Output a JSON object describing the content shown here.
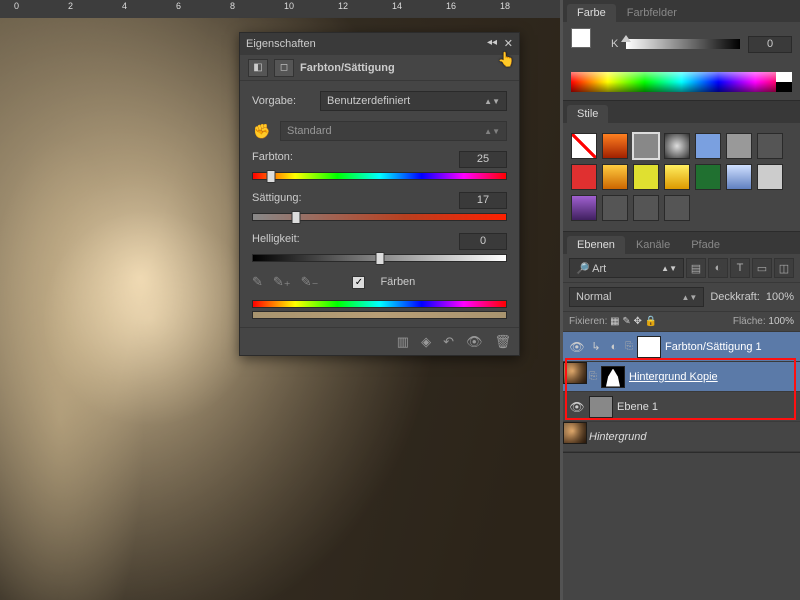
{
  "ruler": {
    "marks": [
      "0",
      "2",
      "4",
      "6",
      "8",
      "10",
      "12",
      "14",
      "16",
      "18"
    ]
  },
  "props": {
    "title": "Eigenschaften",
    "adjustment_name": "Farbton/Sättigung",
    "preset_label": "Vorgabe:",
    "preset_value": "Benutzerdefiniert",
    "channel_value": "Standard",
    "hue_label": "Farbton:",
    "hue_value": "25",
    "sat_label": "Sättigung:",
    "sat_value": "17",
    "lgt_label": "Helligkeit:",
    "lgt_value": "0",
    "colorize_label": "Färben"
  },
  "color_panel": {
    "tabs": [
      "Farbe",
      "Farbfelder"
    ],
    "k_label": "K",
    "k_value": "0"
  },
  "styles_panel": {
    "tab": "Stile"
  },
  "layers_panel": {
    "tabs": [
      "Ebenen",
      "Kanäle",
      "Pfade"
    ],
    "search": "Art",
    "blend": "Normal",
    "opacity_label": "Deckkraft:",
    "opacity_value": "100%",
    "lock_label": "Fixieren:",
    "fill_label": "Fläche:",
    "fill_value": "100%",
    "layers": [
      {
        "name": "Farbton/Sättigung 1"
      },
      {
        "name": "Hintergrund Kopie"
      },
      {
        "name": "Ebene 1"
      },
      {
        "name": "Hintergrund"
      }
    ]
  },
  "style_colors": [
    "#ff6a00",
    "#888",
    "#333",
    "#7aa0e0",
    "#999",
    "#555",
    "#e03030",
    "#ffaa00",
    "#e0e030",
    "#ffcc00",
    "#207030",
    "#90b0e0",
    "#ccc",
    "#8040a0",
    "#555",
    "#555",
    "#555"
  ]
}
